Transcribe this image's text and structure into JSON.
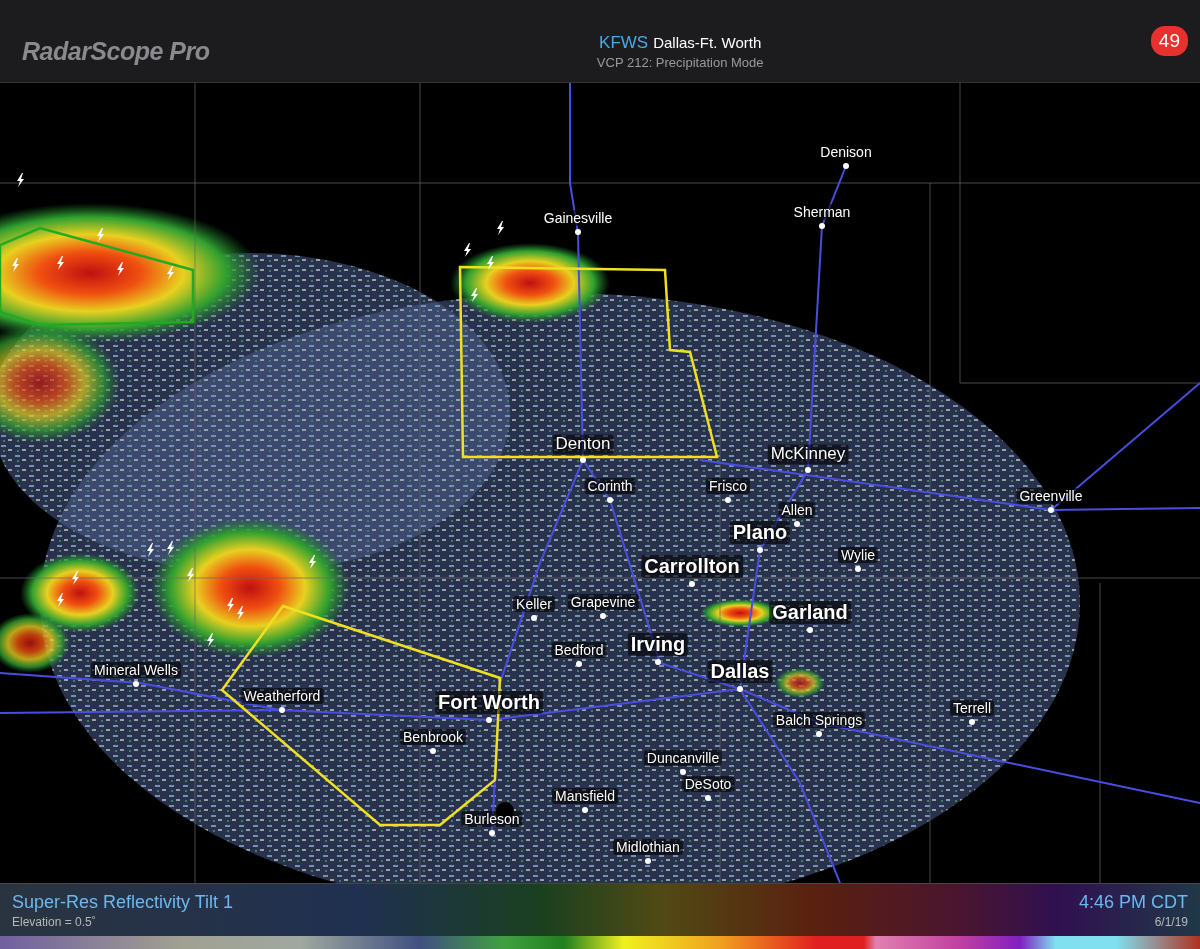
{
  "header": {
    "logo": "RadarScope Pro",
    "site_id": "KFWS",
    "site_name": "Dallas-Ft. Worth",
    "vcp": "VCP 212: Precipitation Mode",
    "badge": "49"
  },
  "map": {
    "warnings": [
      {
        "kind": "polygon",
        "color": "#22aa22"
      },
      {
        "kind": "polygon",
        "color": "#f0e020"
      },
      {
        "kind": "polygon",
        "color": "#f0e020"
      }
    ],
    "cities": [
      {
        "name": "Denison",
        "kind": "small"
      },
      {
        "name": "Sherman",
        "kind": "small"
      },
      {
        "name": "Gainesville",
        "kind": "small"
      },
      {
        "name": "Denton",
        "kind": "medium"
      },
      {
        "name": "McKinney",
        "kind": "medium"
      },
      {
        "name": "Corinth",
        "kind": "small"
      },
      {
        "name": "Frisco",
        "kind": "small"
      },
      {
        "name": "Greenville",
        "kind": "small"
      },
      {
        "name": "Allen",
        "kind": "small"
      },
      {
        "name": "Plano",
        "kind": "large"
      },
      {
        "name": "Wylie",
        "kind": "small"
      },
      {
        "name": "Carrollton",
        "kind": "large"
      },
      {
        "name": "Keller",
        "kind": "small"
      },
      {
        "name": "Grapevine",
        "kind": "small"
      },
      {
        "name": "Garland",
        "kind": "large"
      },
      {
        "name": "Bedford",
        "kind": "small"
      },
      {
        "name": "Irving",
        "kind": "large"
      },
      {
        "name": "Dallas",
        "kind": "large"
      },
      {
        "name": "Mineral Wells",
        "kind": "small"
      },
      {
        "name": "Weatherford",
        "kind": "small"
      },
      {
        "name": "Fort Worth",
        "kind": "large"
      },
      {
        "name": "Terrell",
        "kind": "small"
      },
      {
        "name": "Balch Springs",
        "kind": "small"
      },
      {
        "name": "Benbrook",
        "kind": "small"
      },
      {
        "name": "Duncanville",
        "kind": "small"
      },
      {
        "name": "DeSoto",
        "kind": "small"
      },
      {
        "name": "Mansfield",
        "kind": "small"
      },
      {
        "name": "Burleson",
        "kind": "small"
      },
      {
        "name": "Midlothian",
        "kind": "small"
      }
    ]
  },
  "footer": {
    "product": "Super-Res Reflectivity Tilt 1",
    "elevation": "Elevation = 0.5˚",
    "time": "4:46 PM CDT",
    "date": "6/1/19"
  }
}
